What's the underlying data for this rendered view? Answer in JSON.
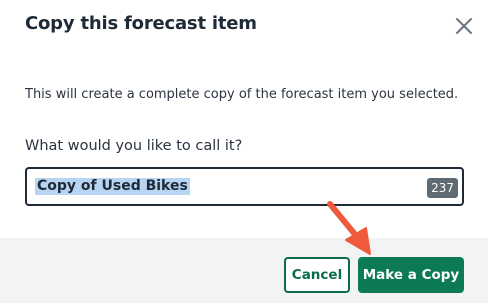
{
  "dialog": {
    "title": "Copy this forecast item",
    "close_icon": "close-icon",
    "description": "This will create a complete copy of the forecast item you selected.",
    "field_label": "What would you like to call it?",
    "input_value": "Copy of Used Bikes",
    "char_counter": "237",
    "cancel_label": "Cancel",
    "confirm_label": "Make a Copy"
  },
  "colors": {
    "primary": "#0c7a52",
    "annotation_arrow": "#f05a3c",
    "selection": "#b7d4f3",
    "footer_bg": "#f2f3f5"
  }
}
